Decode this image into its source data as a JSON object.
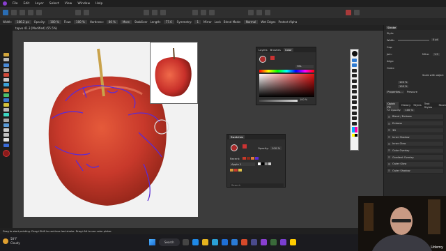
{
  "menu": [
    "File",
    "Edit",
    "Layer",
    "Select",
    "View",
    "Window",
    "Help"
  ],
  "context_toolbar": {
    "width_label": "Width:",
    "width_value": "186.2 px",
    "opacity_label": "Opacity:",
    "opacity_value": "100 %",
    "flow_label": "Flow:",
    "flow_value": "100 %",
    "hardness_label": "Hardness:",
    "hardness_value": "80 %",
    "more_label": "More",
    "stabilizer_label": "Stabilizer",
    "length_label": "Length:",
    "length_value": "77.6",
    "symmetry_label": "Symmetry:",
    "symmetry_value": "1",
    "mirror_label": "Mirror",
    "lock_label": "Lock",
    "blend_mode_label": "Blend Mode:",
    "blend_mode_value": "Normal",
    "wet_edges_label": "Wet Edges",
    "protect_alpha_label": "Protect Alpha"
  },
  "document_tab": "tapvo 41.3 [Modified] (55.5%)",
  "color_panel": {
    "tabs": [
      "Layers",
      "Brushes",
      "Color"
    ],
    "active_tab": "Color",
    "mode_value": "HSL",
    "opacity_value": "100 %"
  },
  "swatches_panel": {
    "title": "Swatches",
    "opacity_label": "Opacity:",
    "opacity_value": "100 %",
    "recent_label": "Recent:",
    "palette_value": "Apple 1",
    "search_placeholder": "Search"
  },
  "stroke_panel": {
    "title": "Stroke",
    "style_label": "Style:",
    "width_label": "Width:",
    "width_value": "0 pt",
    "cap_label": "Cap:",
    "join_label": "Join:",
    "mitre_label": "Mitre:",
    "mitre_value": "1.5",
    "align_label": "Align:",
    "order_label": "Order:",
    "scale_label": "Scale with object",
    "dash1": "100 %",
    "dash2": "100 %",
    "properties_label": "Properties...",
    "pressure_label": "Pressure"
  },
  "fx_panel": {
    "tabs": [
      "Quick FX",
      "History",
      "Styles",
      "Text Styles",
      "Stock"
    ],
    "active_tab": "Quick FX",
    "fx_label": "FX Opacity:",
    "fx_value": "100 %",
    "items": [
      "Blend / Emboss",
      "Emboss",
      "3D",
      "Inner Shadow",
      "Inner Glow",
      "Color Overlay",
      "Gradient Overlay",
      "Outer Glow",
      "Outer Shadow"
    ]
  },
  "status_bar": "Drag to start painting. Drag+Shift to continue last stroke. Drag+Alt to use color picker.",
  "taskbar": {
    "weather_temp": "58°F",
    "weather_desc": "Cloudy",
    "search_label": "Search"
  },
  "watermark": "Udemy",
  "colors": {
    "apple_red": "#c8392b",
    "annotation": "#5b2bd6",
    "accent": "#2f7bd1"
  }
}
